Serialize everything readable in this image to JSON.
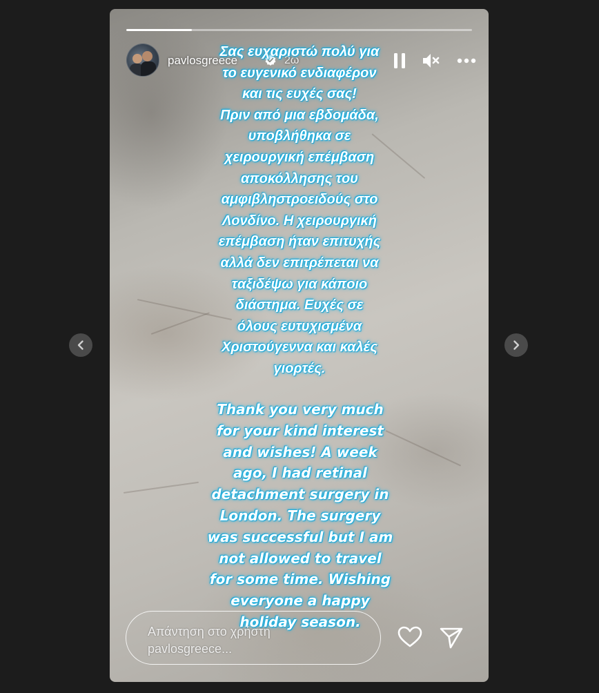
{
  "story": {
    "progress": 0.19,
    "author": {
      "username": "pavlosgreece",
      "verified": true,
      "time_ago": "2ω"
    },
    "controls": {
      "pause_icon": "pause-icon",
      "mute_icon": "muted-speaker-icon",
      "more_icon": "more-horizontal-icon"
    },
    "caption_greek": "Σας ευχαριστώ πολύ για\nτο ευγενικό ενδιαφέρον\nκαι τις ευχές σας!\nΠριν από μια εβδομάδα,\nυποβλήθηκα σε\nχειρουργική επέμβαση\nαποκόλλησης του\nαμφιβληστροειδούς στο\nΛονδίνο. Η χειρουργική\nεπέμβαση ήταν επιτυχής\nαλλά δεν επιτρέπεται να\nταξιδέψω για κάποιο\nδιάστημα. Ευχές σε\nόλους ευτυχισμένα\nΧριστούγεννα και καλές\nγιορτές.",
    "caption_english": "Thank you very much\nfor your kind interest\nand wishes! A week\nago, I had retinal\ndetachment surgery in\nLondon. The surgery\nwas successful but I am\nnot allowed to travel\nfor some time. Wishing\neveryone a happy\nholiday season.",
    "reply": {
      "placeholder": "Απάντηση στο χρήστη pavlosgreece..."
    },
    "actions": {
      "like_icon": "heart-icon",
      "share_icon": "send-icon"
    }
  },
  "navigation": {
    "prev_icon": "chevron-left-icon",
    "next_icon": "chevron-right-icon"
  },
  "colors": {
    "background": "#1c1c1c",
    "caption_glow": "#1ab6e6",
    "nav_button": "#4a4a4a"
  }
}
